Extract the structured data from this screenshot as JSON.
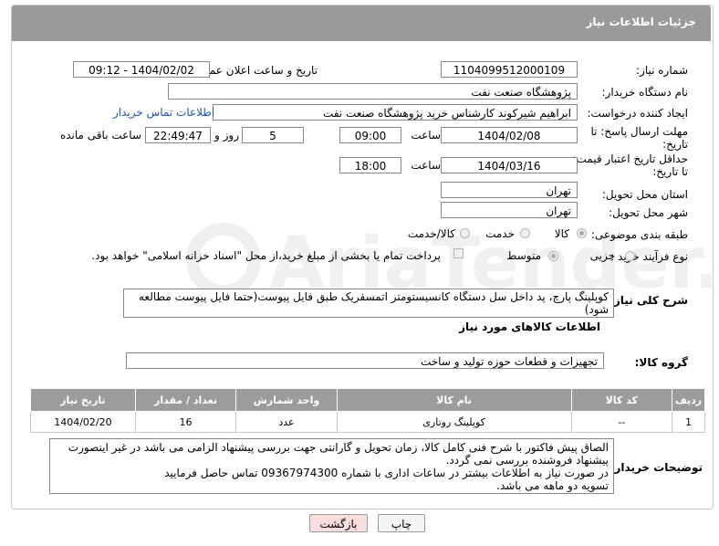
{
  "header": {
    "title": "جزئیات اطلاعات نیاز"
  },
  "fields": {
    "need_number_label": "شماره نیاز:",
    "need_number": "1104099512000109",
    "announce_label": "تاریخ و ساعت اعلان عمومی:",
    "announce_value": "1404/02/02 - 09:12",
    "buyer_org_label": "نام دستگاه خریدار:",
    "buyer_org": "پژوهشگاه صنعت نفت",
    "requester_label": "ایجاد کننده درخواست:",
    "requester": "ابراهیم شیرکوند کارشناس خرید پژوهشگاه صنعت نفت",
    "contact_link": "اطلاعات تماس خریدار",
    "deadline_label_1": "مهلت ارسال پاسخ: تا",
    "deadline_label_2": "تاریخ:",
    "deadline_date": "1404/02/08",
    "time_label": "ساعت",
    "deadline_time": "09:00",
    "days_value": "5",
    "days_label": "روز و",
    "remaining_time": "22:49:47",
    "remaining_label": "ساعت باقی مانده",
    "min_validity_label_1": "حداقل تاریخ اعتبار قیمت:",
    "min_validity_label_2": "تا تاریخ:",
    "validity_date": "1404/03/16",
    "validity_time": "18:00",
    "delivery_province_label": "استان محل تحویل:",
    "delivery_province": "تهران",
    "delivery_city_label": "شهر محل تحویل:",
    "delivery_city": "تهران",
    "category_label": "طبقه بندی موضوعی:",
    "category_options": [
      "کالا",
      "خدمت",
      "کالا/خدمت"
    ],
    "process_label": "نوع فرآیند خرید :",
    "process_options": [
      "جزیی",
      "متوسط"
    ],
    "payment_note": "پرداخت تمام یا بخشی از مبلغ خرید،از محل \"اسناد خزانه اسلامی\" خواهد بود."
  },
  "description": {
    "label": "شرح کلی نیاز:",
    "text": "کوپلینگ پارچ، پد داخل سل دستگاه کانسیستومتر اتمسفریک طبق فایل پیوست(حتما فایل پیوست مطالعه شود)"
  },
  "goods_section": {
    "title": "اطلاعات کالاهای مورد نیاز",
    "group_label": "گروه کالا:",
    "group_value": "تجهیزات و قطعات حوزه تولید و ساخت"
  },
  "table": {
    "headers": [
      "ردیف",
      "کد کالا",
      "نام کالا",
      "واحد شمارش",
      "تعداد / مقدار",
      "تاریخ نیاز"
    ],
    "rows": [
      [
        "1",
        "--",
        "کوپلینگ روتاری",
        "عدد",
        "16",
        "1404/02/20"
      ]
    ]
  },
  "buyer_notes": {
    "label": "توضیحات خریدار:",
    "lines": [
      "الصاق پیش فاکتور با شرح فنی کامل کالا، زمان تحویل و گارانتی جهت بررسی پیشنهاد الزامی می باشد در غیر اینصورت",
      "پیشنهاد فروشنده بررسی نمی گردد.",
      "در صورت نیاز به اطلاعات بیشتر در ساعات اداری با شماره 09367974300 تماس حاصل فرمایید",
      "تسویه دو ماهه می باشد."
    ]
  },
  "buttons": {
    "print": "چاپ",
    "back": "بازگشت"
  },
  "watermark": {
    "text": "AriaTender.neT"
  },
  "colors": {
    "header_bg": "#9a9a9a",
    "link": "#1a56b4",
    "back_btn_bg": "#f9dede"
  }
}
